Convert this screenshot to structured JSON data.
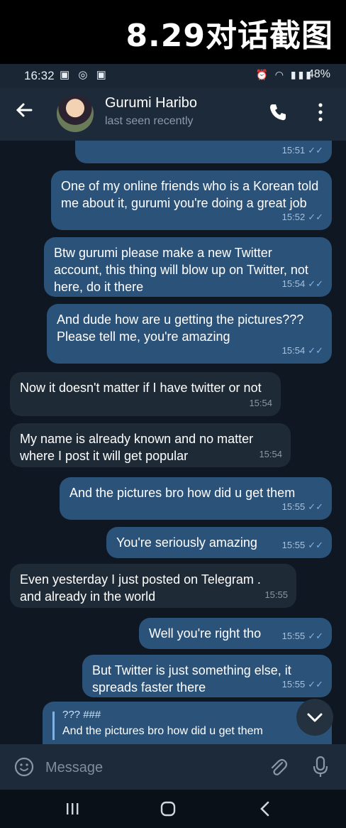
{
  "banner": {
    "title": "8.29对话截图"
  },
  "status": {
    "time": "16:32",
    "battery": "48%"
  },
  "header": {
    "name": "Gurumi Haribo",
    "subtitle": "last seen recently"
  },
  "messages": [
    {
      "text": "",
      "time": "15:51",
      "dir": "out"
    },
    {
      "text": "One of my online friends who is a Korean told me about it, gurumi you're doing a great job",
      "time": "15:52",
      "dir": "out"
    },
    {
      "text": "Btw gurumi please make a new Twitter account, this thing will blow up on Twitter, not here, do it there",
      "time": "15:54",
      "dir": "out"
    },
    {
      "text": "And dude how are u getting the pictures??? Please tell me, you're amazing",
      "time": "15:54",
      "dir": "out"
    },
    {
      "text": "Now it doesn't matter if I have twitter or not",
      "time": "15:54",
      "dir": "in"
    },
    {
      "text": "My name is already known and no matter where I post it will get popular",
      "time": "15:54",
      "dir": "in"
    },
    {
      "text": "And the pictures bro how did u get them",
      "time": "15:55",
      "dir": "out"
    },
    {
      "text": "You're seriously amazing",
      "time": "15:55",
      "dir": "out"
    },
    {
      "text": "Even yesterday I just posted on Telegram . and already in the world",
      "time": "15:55",
      "dir": "in"
    },
    {
      "text": "Well you're right tho",
      "time": "15:55",
      "dir": "out"
    },
    {
      "text": "But Twitter is just something else, it spreads faster there",
      "time": "15:55",
      "dir": "out"
    }
  ],
  "reply": {
    "sender": "??? ###",
    "text": "And the pictures bro how did u get them"
  },
  "input": {
    "placeholder": "Message"
  },
  "colors": {
    "outgoing": "#2b5279",
    "incoming": "#1f2a37",
    "background": "#0e1722",
    "accent": "#7fb2e5"
  }
}
